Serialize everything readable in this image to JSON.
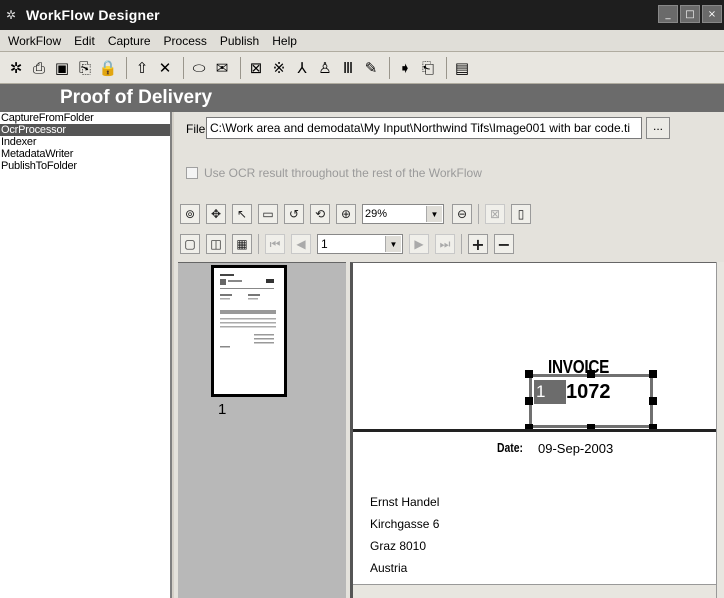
{
  "window": {
    "title": "WorkFlow Designer",
    "controls": [
      "_",
      "□",
      "×"
    ]
  },
  "menu": [
    "WorkFlow",
    "Edit",
    "Capture",
    "Process",
    "Publish",
    "Help"
  ],
  "toolbar": {
    "icons": [
      [
        "new-workflow-icon",
        "✲"
      ],
      [
        "print-icon",
        "⎙"
      ],
      [
        "save-icon",
        "▣"
      ],
      [
        "save-as-icon",
        "⎘"
      ],
      [
        "lock-icon",
        "🔒"
      ],
      "sep",
      [
        "move-up-icon",
        "⇧"
      ],
      [
        "delete-icon",
        "✕"
      ],
      "sep",
      [
        "capture-icon",
        "⬭"
      ],
      [
        "mail-icon",
        "✉"
      ],
      "sep",
      [
        "scanner-icon",
        "⊠"
      ],
      [
        "ocr-icon",
        "※"
      ],
      [
        "pdf-icon",
        "⅄"
      ],
      [
        "metadata-icon",
        "♙"
      ],
      [
        "barcode-icon",
        "Ⅲ"
      ],
      [
        "pen-icon",
        "✎"
      ],
      "sep",
      [
        "publish-icon",
        "➧"
      ],
      [
        "publish-folder-icon",
        "⎗"
      ],
      "sep",
      [
        "properties-icon",
        "▤"
      ]
    ]
  },
  "banner": "Proof of Delivery",
  "steps": [
    {
      "label": "CaptureFromFolder",
      "selected": false
    },
    {
      "label": "OcrProcessor",
      "selected": true
    },
    {
      "label": "Indexer",
      "selected": false
    },
    {
      "label": "MetadataWriter",
      "selected": false
    },
    {
      "label": "PublishToFolder",
      "selected": false
    }
  ],
  "file": {
    "label": "File",
    "value": "C:\\Work area and demodata\\My Input\\Northwind Tifs\\Image001 with bar code.ti",
    "browse_label": "..."
  },
  "ocr_option": {
    "label": "Use OCR result throughout the rest of the WorkFlow",
    "checked": false,
    "enabled": false
  },
  "viewer": {
    "zoom": "29%",
    "page": "1",
    "thumb_page_number": "1"
  },
  "document": {
    "title": "INVOICE",
    "zone_number": "1",
    "invoice_number": "1072",
    "date_label": "Date:",
    "date_value": "09-Sep-2003",
    "address": [
      "Ernst Handel",
      "Kirchgasse 6",
      "Graz  8010",
      "Austria"
    ]
  },
  "colors": {
    "titlebar": "#1e1e1e",
    "banner": "#6b6b6b",
    "selected_step": "#555555"
  }
}
